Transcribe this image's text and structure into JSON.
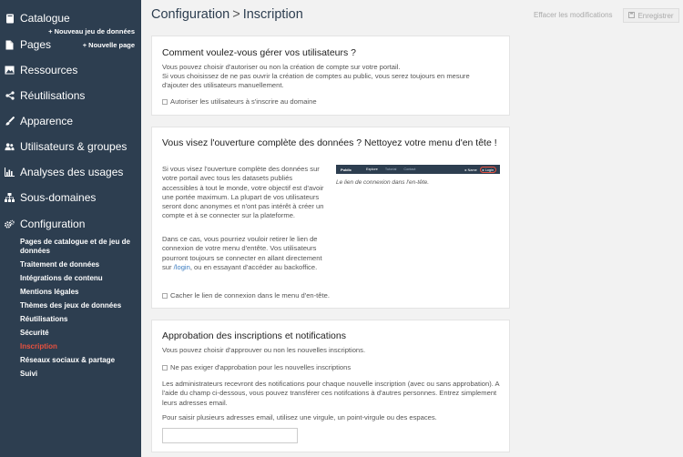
{
  "sidebar": {
    "items": [
      {
        "name": "catalogue",
        "label": "Catalogue",
        "icon": "book-icon",
        "action": "+ Nouveau jeu de données"
      },
      {
        "name": "pages",
        "label": "Pages",
        "icon": "document-icon",
        "action": "+ Nouvelle page"
      },
      {
        "name": "ressources",
        "label": "Ressources",
        "icon": "image-icon"
      },
      {
        "name": "reutilisations",
        "label": "Réutilisations",
        "icon": "share-icon"
      },
      {
        "name": "apparence",
        "label": "Apparence",
        "icon": "brush-icon"
      },
      {
        "name": "utilisateurs",
        "label": "Utilisateurs & groupes",
        "icon": "users-icon"
      },
      {
        "name": "analyses",
        "label": "Analyses des usages",
        "icon": "bar-chart-icon"
      },
      {
        "name": "sous-domaines",
        "label": "Sous-domaines",
        "icon": "sitemap-icon"
      },
      {
        "name": "configuration",
        "label": "Configuration",
        "icon": "gears-icon"
      }
    ],
    "subitems": [
      "Pages de catalogue et de jeu de données",
      "Traitement de données",
      "Intégrations de contenu",
      "Mentions légales",
      "Thèmes des jeux de données",
      "Réutilisations",
      "Sécurité",
      "Inscription",
      "Réseaux sociaux & partage",
      "Suivi"
    ],
    "active_subitem": "Inscription"
  },
  "header": {
    "section": "Configuration",
    "separator": ">",
    "page": "Inscription",
    "clear_label": "Effacer les modifications",
    "save_label": "Enregistrer"
  },
  "card1": {
    "title": "Comment voulez-vous gérer vos utilisateurs ?",
    "text1": "Vous pouvez choisir d'autoriser ou non la création de compte sur votre portail.",
    "text2": "Si vous choisissez de ne pas ouvrir la création de comptes au public, vous serez toujours en mesure d'ajouter des utilisateurs manuellement.",
    "checkbox_label": "Autoriser les utilisateurs à s'inscrire au domaine"
  },
  "card2": {
    "title": "Vous visez l'ouverture complète des données ? Nettoyez votre menu d'en tête !",
    "para1": "Si vous visez l'ouverture complète des données sur votre portail avec tous les datasets publiés accessibles à tout le monde, votre objectif est d'avoir une portée maximum. La plupart de vos utilisateurs seront donc anonymes et n'ont pas intérêt à créer un compte et à se connecter sur la plateforme.",
    "para2_before": "Dans ce cas, vous pourriez vouloir retirer le lien de connexion de votre menu d'entête. Vos utilisateurs pourront toujours se connecter en allant directement sur ",
    "para2_link": "/login",
    "para2_after": ", ou en essayant d'accéder au backoffice.",
    "preview": {
      "logo": "Public",
      "tabs": [
        "Explore",
        "Tutorial",
        "Contact"
      ],
      "user": "▸ Name",
      "login": "▸ Login"
    },
    "caption": "Le lien de connexion dans l'en-tête.",
    "checkbox_label": "Cacher le lien de connexion dans le menu d'en-tête."
  },
  "card3": {
    "title": "Approbation des inscriptions et notifications",
    "text1": "Vous pouvez choisir d'approuver ou non les nouvelles inscriptions.",
    "checkbox_label": "Ne pas exiger d'approbation pour les nouvelles inscriptions",
    "text2": "Les administrateurs recevront des notifications pour chaque nouvelle inscription (avec ou sans approbation). A l'aide du champ ci-dessous, vous pouvez transférer ces notifcations à d'autres personnes. Entrez simplement leurs adresses email.",
    "text3": "Pour saisir plusieurs adresses email, utilisez une virgule, un point-virgule ou des espaces.",
    "email_value": ""
  },
  "colors": {
    "sidebar_bg": "#2d3e50",
    "active": "#e8513f",
    "link": "#3b7bbf"
  }
}
